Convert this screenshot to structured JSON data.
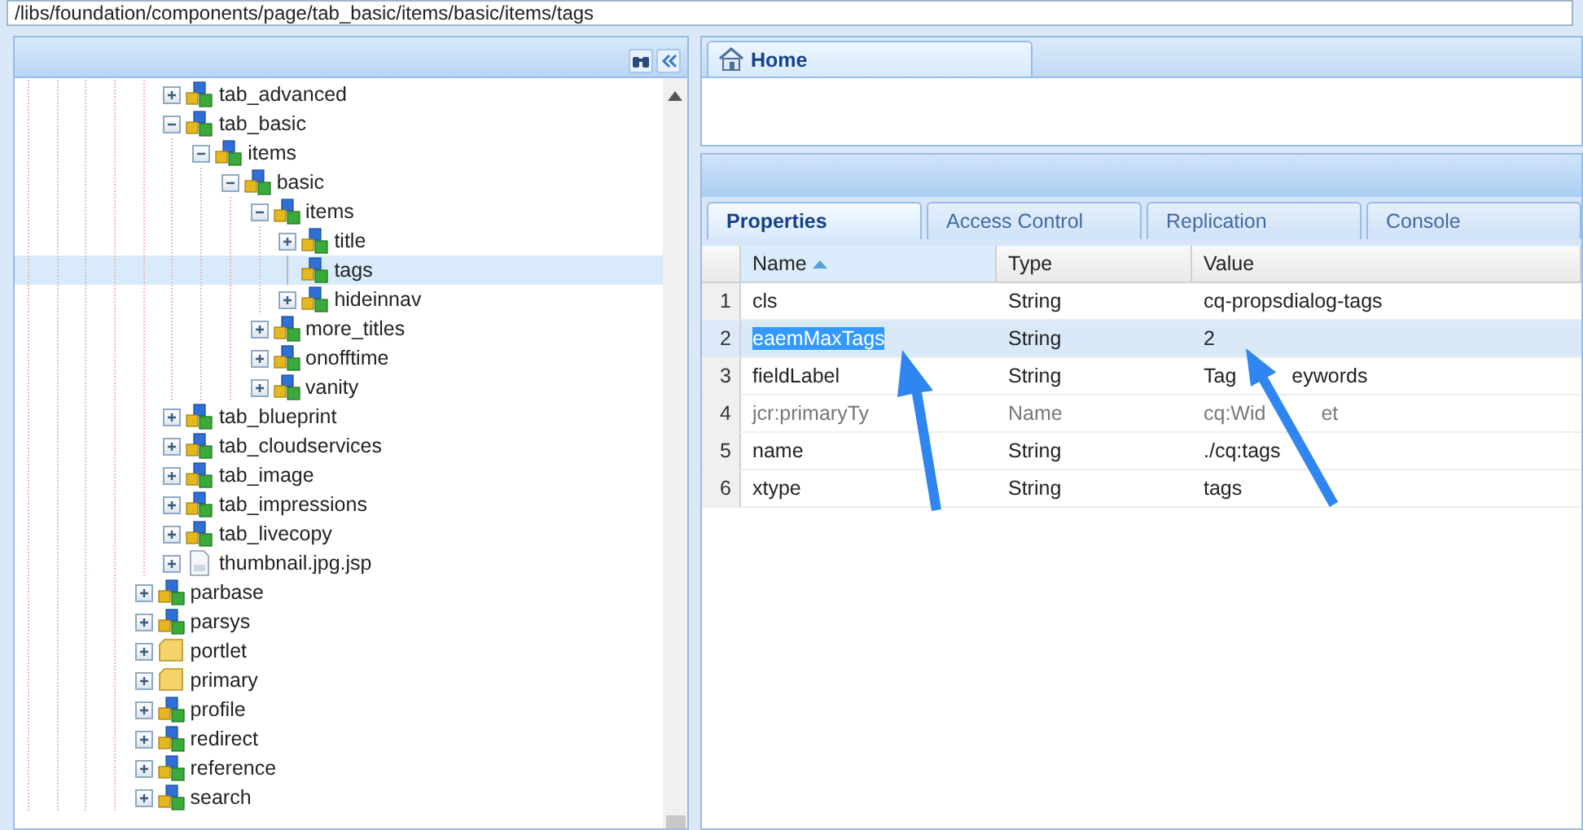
{
  "path_field": {
    "value": "/libs/foundation/components/page/tab_basic/items/basic/items/tags"
  },
  "tree": {
    "partial_branch": [
      {
        "label": "tab_advanced",
        "kind": "component",
        "expanded": false,
        "selected": false
      },
      {
        "label": "tab_basic",
        "kind": "component",
        "expanded": true,
        "selected": false,
        "children": [
          {
            "label": "items",
            "kind": "component",
            "expanded": true,
            "selected": false,
            "children": [
              {
                "label": "basic",
                "kind": "component",
                "expanded": true,
                "selected": false,
                "children": [
                  {
                    "label": "items",
                    "kind": "component",
                    "expanded": true,
                    "selected": false,
                    "children": [
                      {
                        "label": "title",
                        "kind": "component",
                        "expanded": false,
                        "selected": false
                      },
                      {
                        "label": "tags",
                        "kind": "component",
                        "leaf": true,
                        "selected": true
                      },
                      {
                        "label": "hideinnav",
                        "kind": "component",
                        "expanded": false,
                        "selected": false
                      }
                    ]
                  },
                  {
                    "label": "more_titles",
                    "kind": "component",
                    "expanded": false,
                    "selected": false
                  },
                  {
                    "label": "onofftime",
                    "kind": "component",
                    "expanded": false,
                    "selected": false
                  },
                  {
                    "label": "vanity",
                    "kind": "component",
                    "expanded": false,
                    "selected": false
                  }
                ]
              }
            ]
          }
        ]
      },
      {
        "label": "tab_blueprint",
        "kind": "component",
        "expanded": false,
        "selected": false
      },
      {
        "label": "tab_cloudservices",
        "kind": "component",
        "expanded": false,
        "selected": false
      },
      {
        "label": "tab_image",
        "kind": "component",
        "expanded": false,
        "selected": false
      },
      {
        "label": "tab_impressions",
        "kind": "component",
        "expanded": false,
        "selected": false
      },
      {
        "label": "tab_livecopy",
        "kind": "component",
        "expanded": false,
        "selected": false
      },
      {
        "label": "thumbnail.jpg.jsp",
        "kind": "file",
        "expanded": false,
        "selected": false
      }
    ],
    "items": [
      {
        "label": "parbase",
        "kind": "component",
        "expanded": false,
        "selected": false
      },
      {
        "label": "parsys",
        "kind": "component",
        "expanded": false,
        "selected": false
      },
      {
        "label": "portlet",
        "kind": "folder",
        "expanded": false,
        "selected": false
      },
      {
        "label": "primary",
        "kind": "folder",
        "expanded": false,
        "selected": false
      },
      {
        "label": "profile",
        "kind": "component",
        "expanded": false,
        "selected": false
      },
      {
        "label": "redirect",
        "kind": "component",
        "expanded": false,
        "selected": false
      },
      {
        "label": "reference",
        "kind": "component",
        "expanded": false,
        "selected": false
      },
      {
        "label": "search",
        "kind": "component",
        "expanded": false,
        "selected": false
      }
    ]
  },
  "home_tab": {
    "label": "Home"
  },
  "tabs": [
    {
      "label": "Properties",
      "selected": true
    },
    {
      "label": "Access Control",
      "selected": false
    },
    {
      "label": "Replication",
      "selected": false
    },
    {
      "label": "Console",
      "selected": false
    }
  ],
  "grid": {
    "columns": [
      {
        "label": "Name",
        "sorted": true
      },
      {
        "label": "Type",
        "sorted": false
      },
      {
        "label": "Value",
        "sorted": false
      }
    ],
    "rows": [
      {
        "index": "1",
        "name": "cls",
        "type": "String",
        "value": "cq-propsdialog-tags",
        "selected": false,
        "muted": false,
        "name_highlighted": false
      },
      {
        "index": "2",
        "name": "eaemMaxTags",
        "type": "String",
        "value": "2",
        "selected": true,
        "muted": false,
        "name_highlighted": true
      },
      {
        "index": "3",
        "name": "fieldLabel",
        "type": "String",
        "value": [
          "Tag",
          "eywords"
        ],
        "selected": false,
        "muted": false,
        "name_highlighted": false
      },
      {
        "index": "4",
        "name": "jcr:primaryTy",
        "type": "Name",
        "value": [
          "cq:Wid",
          "et"
        ],
        "selected": false,
        "muted": true,
        "name_highlighted": false
      },
      {
        "index": "5",
        "name": "name",
        "type": "String",
        "value": "./cq:tags",
        "selected": false,
        "muted": false,
        "name_highlighted": false
      },
      {
        "index": "6",
        "name": "xtype",
        "type": "String",
        "value": "tags",
        "selected": false,
        "muted": false,
        "name_highlighted": false
      }
    ]
  }
}
